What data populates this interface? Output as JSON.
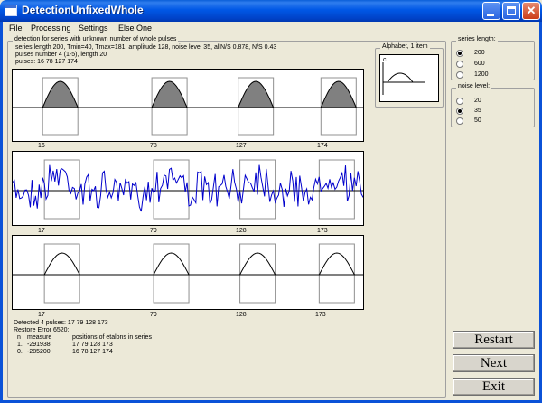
{
  "window": {
    "title": "DetectionUnfixedWhole"
  },
  "menu": [
    "File",
    "Processing",
    "Settings",
    "Else One"
  ],
  "main_group": {
    "title": "detection for series with unknown number of whole pulses",
    "lines": [
      "series length 200,  Tmin=40,  Tmax=181,  amplitude 128, noise level 35, allN/S 0.878,  N/S 0.43",
      "pulses number 4 (1-5), length 20",
      "pulses:  16 78 127 174"
    ]
  },
  "plots": [
    {
      "name": "original",
      "labels": [
        "16",
        "78",
        "127",
        "174"
      ],
      "positions": [
        16,
        78,
        127,
        174
      ]
    },
    {
      "name": "noisy",
      "labels": [
        "17",
        "79",
        "128",
        "173"
      ],
      "positions": [
        17,
        79,
        128,
        173
      ]
    },
    {
      "name": "restored",
      "labels": [
        "17",
        "79",
        "128",
        "173"
      ],
      "positions": [
        17,
        79,
        128,
        173
      ]
    }
  ],
  "alphabet": {
    "title": "Alphabet, 1 item",
    "letter": "c"
  },
  "series_length": {
    "title": "series length:",
    "options": [
      "200",
      "600",
      "1200"
    ],
    "selected": 0
  },
  "noise_level": {
    "title": "noise level:",
    "options": [
      "20",
      "35",
      "50"
    ],
    "selected": 1
  },
  "results": {
    "detected": "Detected 4 pulses:  17 79 128 173",
    "restore_error": "Restore Error 6520:",
    "col_n": "n",
    "col_measure": "measure",
    "col_positions": "positions of etalons in series",
    "rows": [
      {
        "n": "1.",
        "measure": "-291938",
        "positions": "17  79  128  173"
      },
      {
        "n": "0.",
        "measure": "-285200",
        "positions": "16  78  127  174"
      }
    ]
  },
  "buttons": {
    "restart": "Restart",
    "next": "Next",
    "exit": "Exit"
  }
}
